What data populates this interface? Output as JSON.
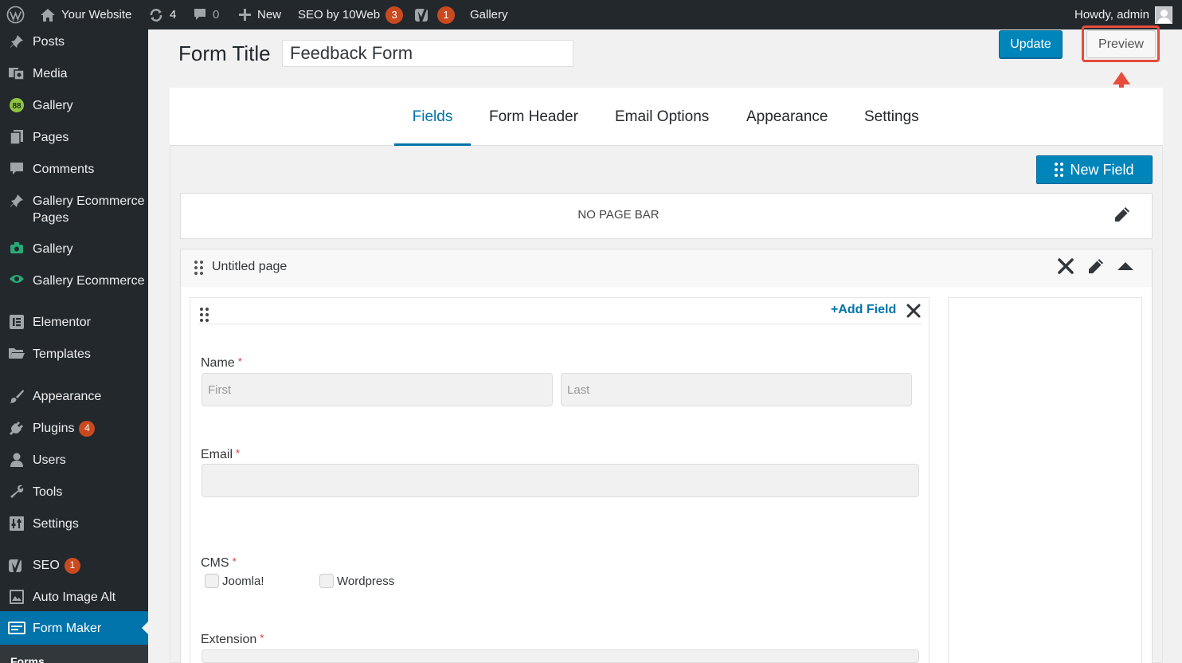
{
  "adminbar": {
    "site_name": "Your Website",
    "updates_count": "4",
    "comments_count": "0",
    "new_label": "New",
    "seo_label": "SEO by 10Web",
    "seo_count": "3",
    "yoast_count": "1",
    "gallery_label": "Gallery",
    "howdy": "Howdy, admin"
  },
  "sidebar": {
    "items": [
      {
        "label": "Posts",
        "icon": "pin-icon"
      },
      {
        "label": "Media",
        "icon": "media-icon"
      },
      {
        "label": "Gallery",
        "icon": "gallery-icon"
      },
      {
        "label": "Pages",
        "icon": "pages-icon"
      },
      {
        "label": "Comments",
        "icon": "comments-icon"
      },
      {
        "label": "Gallery Ecommerce Pages",
        "icon": "pin-icon"
      },
      {
        "label": "Gallery",
        "icon": "camera-icon"
      },
      {
        "label": "Gallery Ecommerce",
        "icon": "eye-icon"
      },
      {
        "label": "Elementor",
        "icon": "elementor-icon"
      },
      {
        "label": "Templates",
        "icon": "folder-icon"
      },
      {
        "label": "Appearance",
        "icon": "brush-icon"
      },
      {
        "label": "Plugins",
        "icon": "plug-icon",
        "badge": "4"
      },
      {
        "label": "Users",
        "icon": "user-icon"
      },
      {
        "label": "Tools",
        "icon": "wrench-icon"
      },
      {
        "label": "Settings",
        "icon": "settings-icon"
      },
      {
        "label": "SEO",
        "icon": "yoast-icon",
        "badge": "1"
      },
      {
        "label": "Auto Image Alt",
        "icon": "image-icon"
      },
      {
        "label": "Form Maker",
        "icon": "form-icon"
      }
    ],
    "submenu_first": "Forms"
  },
  "header": {
    "form_title_label": "Form Title",
    "form_title_value": "Feedback Form",
    "update_label": "Update",
    "preview_label": "Preview"
  },
  "tabs": [
    "Fields",
    "Form Header",
    "Email Options",
    "Appearance",
    "Settings"
  ],
  "active_tab": "Fields",
  "toolbar": {
    "new_field_label": "New Field"
  },
  "pagebar": {
    "label": "NO PAGE BAR"
  },
  "page": {
    "name": "Untitled page",
    "add_field_label": "Add Field"
  },
  "fields": {
    "name": {
      "label": "Name",
      "required": "*",
      "first_placeholder": "First",
      "last_placeholder": "Last"
    },
    "email": {
      "label": "Email",
      "required": "*"
    },
    "cms": {
      "label": "CMS",
      "required": "*",
      "options": [
        "Joomla!",
        "Wordpress"
      ]
    },
    "extension": {
      "label": "Extension",
      "required": "*"
    }
  },
  "colors": {
    "admin_dark": "#23282d",
    "primary_blue": "#0085ba",
    "link_blue": "#0073aa",
    "badge_orange": "#ca4a1f",
    "highlight_red": "#e74c3c"
  }
}
